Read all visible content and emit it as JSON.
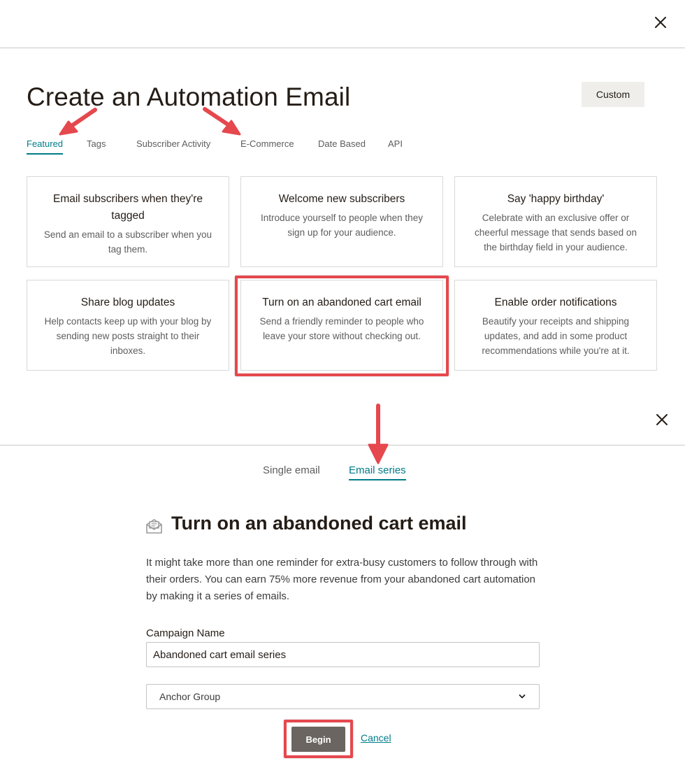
{
  "top_panel": {
    "title": "Create an Automation Email",
    "custom_button": "Custom",
    "tabs": [
      {
        "label": "Featured",
        "active": true
      },
      {
        "label": "Tags",
        "active": false
      },
      {
        "label": "Subscriber Activity",
        "active": false
      },
      {
        "label": "E-Commerce",
        "active": false
      },
      {
        "label": "Date Based",
        "active": false
      },
      {
        "label": "API",
        "active": false
      }
    ],
    "cards": [
      {
        "title": "Email subscribers when they're tagged",
        "desc": "Send an email to a subscriber when you tag them."
      },
      {
        "title": "Welcome new subscribers",
        "desc": "Introduce yourself to people when they sign up for your audience."
      },
      {
        "title": "Say 'happy birthday'",
        "desc": "Celebrate with an exclusive offer or cheerful message that sends based on the birthday field in your audience."
      },
      {
        "title": "Share blog updates",
        "desc": "Help contacts keep up with your blog by sending new posts straight to their inboxes."
      },
      {
        "title": "Turn on an abandoned cart email",
        "desc": "Send a friendly reminder to people who leave your store without checking out."
      },
      {
        "title": "Enable order notifications",
        "desc": "Beautify your receipts and shipping updates, and add in some product recommendations while you're at it."
      }
    ]
  },
  "bottom_panel": {
    "tabs": [
      {
        "label": "Single email",
        "active": false
      },
      {
        "label": "Email series",
        "active": true
      }
    ],
    "section_icon": "envelope-open-icon",
    "section_title": "Turn on an abandoned cart email",
    "description": "It might take more than one reminder for extra-busy customers to follow through with their orders. You can earn 75% more revenue from your abandoned cart automation by making it a series of emails.",
    "campaign_name_label": "Campaign Name",
    "campaign_name_value": "Abandoned cart email series",
    "audience_selected": "Anchor Group",
    "begin_button": "Begin",
    "cancel_link": "Cancel"
  },
  "colors": {
    "accent": "#007c89",
    "annotation_red": "#e5484d",
    "primary_button": "#6b6561",
    "secondary_button_bg": "#efeeea"
  }
}
